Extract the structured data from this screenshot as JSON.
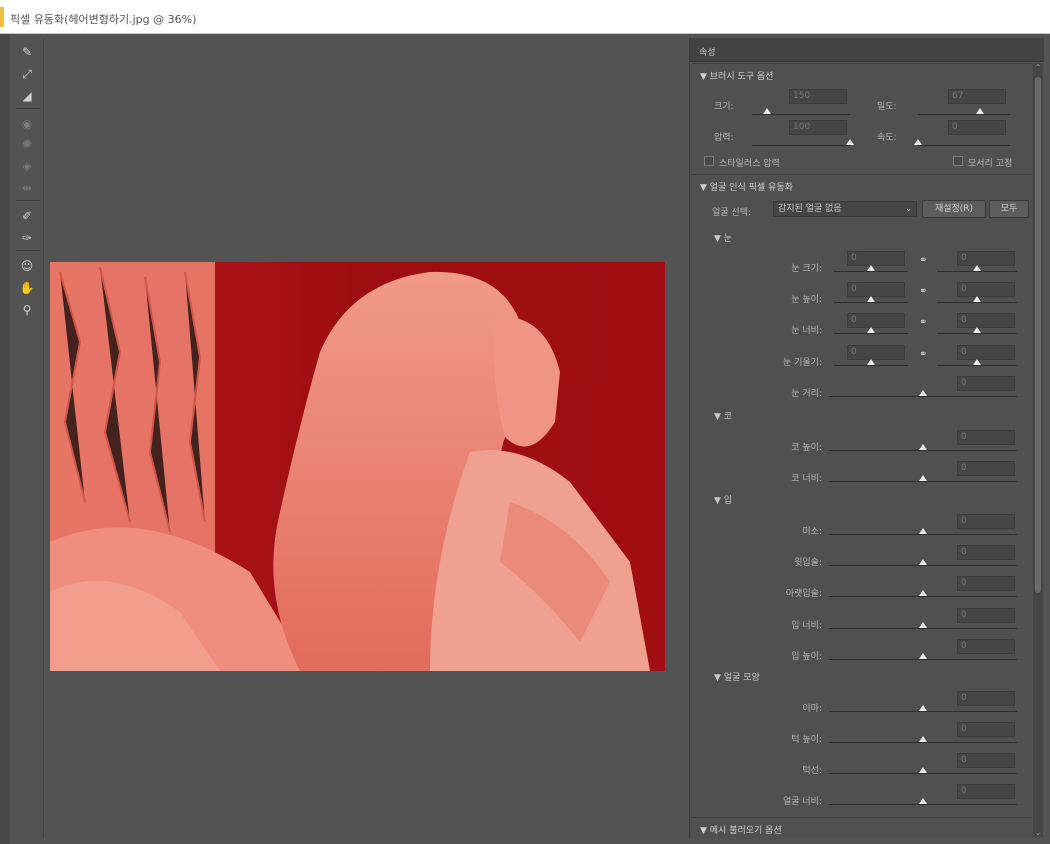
{
  "window": {
    "title": "픽셀 유동화(헤어변형하기.jpg @ 36%)"
  },
  "tools": [
    {
      "name": "forward-warp-tool-icon",
      "glyph": "✎",
      "dim": false
    },
    {
      "name": "reconstruct-tool-icon",
      "glyph": "⤢",
      "dim": false
    },
    {
      "name": "smooth-tool-icon",
      "glyph": "◢",
      "dim": false
    },
    {
      "name": "twirl-tool-icon",
      "glyph": "◉",
      "dim": true
    },
    {
      "name": "pucker-tool-icon",
      "glyph": "✺",
      "dim": true
    },
    {
      "name": "bloat-tool-icon",
      "glyph": "◈",
      "dim": true
    },
    {
      "name": "push-left-tool-icon",
      "glyph": "⇹",
      "dim": true
    },
    {
      "name": "freeze-mask-tool-icon",
      "glyph": "✐",
      "dim": false
    },
    {
      "name": "thaw-mask-tool-icon",
      "glyph": "✑",
      "dim": false
    },
    {
      "name": "face-tool-icon",
      "glyph": "☺",
      "dim": false
    },
    {
      "name": "hand-tool-icon",
      "glyph": "✋",
      "dim": false
    },
    {
      "name": "zoom-tool-icon",
      "glyph": "⚲",
      "dim": false
    }
  ],
  "panel": {
    "header": "속성",
    "brush": {
      "title": "▼ 브러시 도구 옵션",
      "size": {
        "label": "크기:",
        "value": "150",
        "level": 0.15
      },
      "density": {
        "label": "밀도:",
        "value": "67",
        "level": 0.67
      },
      "pressure": {
        "label": "압력:",
        "value": "100",
        "level": 1.0
      },
      "rate": {
        "label": "속도:",
        "value": "0",
        "level": 0.0
      },
      "stylus": "스타일러스 압력",
      "pin_edges": "모서리 고정"
    },
    "face": {
      "title": "▼ 얼굴 인식 픽셀 유동화",
      "select_label": "얼굴 선택:",
      "select_value": "감지된 얼굴 없음",
      "reset": "재설정(R)",
      "all": "모두",
      "eyes": {
        "title": "▼ 눈",
        "rows": [
          {
            "label": "눈 크기:",
            "left": "0",
            "right": "0"
          },
          {
            "label": "눈 높이:",
            "left": "0",
            "right": "0"
          },
          {
            "label": "눈 너비:",
            "left": "0",
            "right": "0"
          },
          {
            "label": "눈 기울기:",
            "left": "0",
            "right": "0"
          },
          {
            "label": "눈 거리:",
            "value": "0"
          }
        ]
      },
      "nose": {
        "title": "▼ 코",
        "rows": [
          {
            "label": "코 높이:",
            "value": "0"
          },
          {
            "label": "코 너비:",
            "value": "0"
          }
        ]
      },
      "mouth": {
        "title": "▼ 입",
        "rows": [
          {
            "label": "미소:",
            "value": "0"
          },
          {
            "label": "윗입술:",
            "value": "0"
          },
          {
            "label": "아랫입술:",
            "value": "0"
          },
          {
            "label": "입 너비:",
            "value": "0"
          },
          {
            "label": "입 높이:",
            "value": "0"
          }
        ]
      },
      "shape": {
        "title": "▼ 얼굴 모양",
        "rows": [
          {
            "label": "이마:",
            "value": "0"
          },
          {
            "label": "턱 높이:",
            "value": "0"
          },
          {
            "label": "턱선:",
            "value": "0"
          },
          {
            "label": "얼굴 너비:",
            "value": "0"
          }
        ]
      }
    },
    "mesh": {
      "title": "▼ 메시 불러오기 옵션"
    }
  },
  "colors": {
    "overlay": "#e05050",
    "bg_dark": "#9a0c10",
    "ui_bg": "#535353"
  }
}
